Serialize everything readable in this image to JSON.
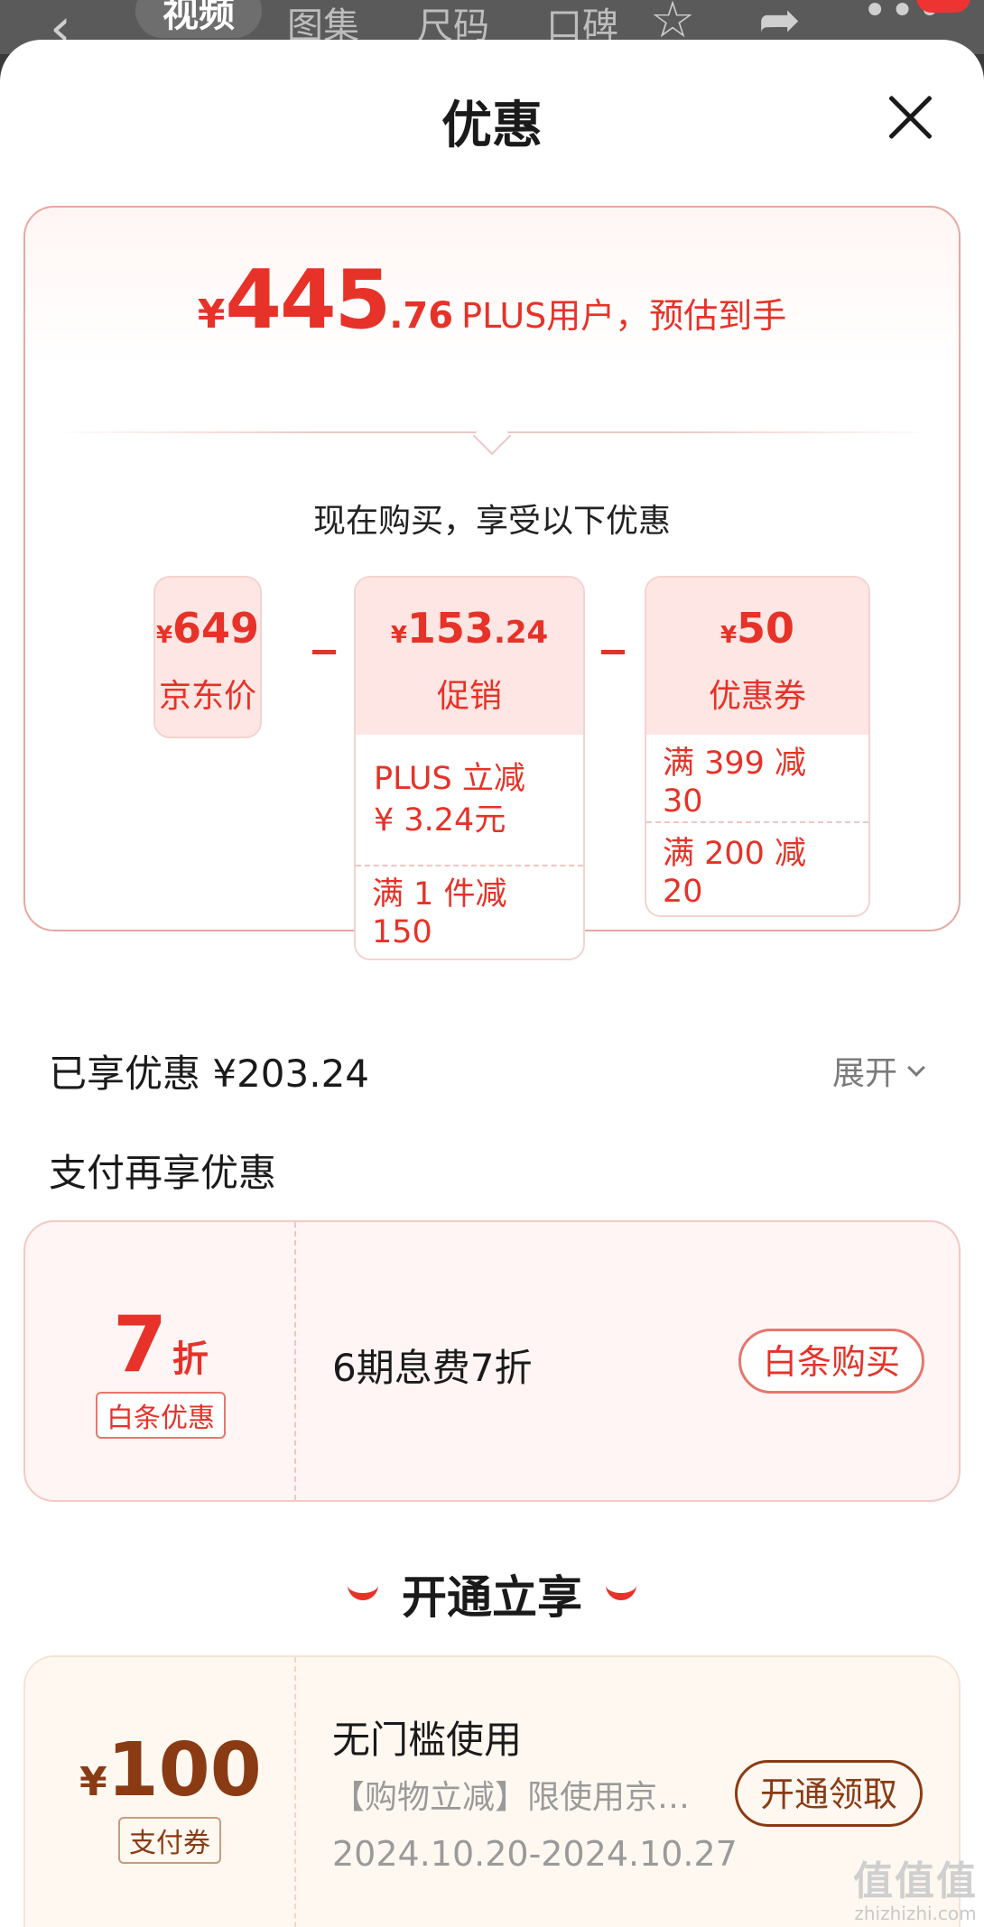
{
  "appbar": {
    "tabs": [
      "视频",
      "图集",
      "尺码",
      "口碑"
    ]
  },
  "sheet": {
    "title": "优惠"
  },
  "summary": {
    "currency": "¥",
    "price_int": "445",
    "price_dec": ".76",
    "price_label": "PLUS用户，预估到手",
    "buy_now": "现在购买，享受以下优惠",
    "jd_price": {
      "amount": "649",
      "label": "京东价"
    },
    "promo": {
      "amount_int": "153",
      "amount_dec": ".24",
      "label": "促销",
      "details": [
        "PLUS 立减\n¥ 3.24元",
        "满 1 件减 150"
      ],
      "detail_line1": "PLUS 立减",
      "detail_line2": "¥ 3.24元",
      "detail_2": "满 1 件减 150"
    },
    "coupon": {
      "amount": "50",
      "label": "优惠券",
      "detail_1": "满 399 减 30",
      "detail_2": "满 200 减 20"
    }
  },
  "enjoyed": {
    "text": "已享优惠 ¥203.24",
    "expand_label": "展开"
  },
  "pay_section": {
    "title": "支付再享优惠",
    "discount_num": "7",
    "discount_unit": "折",
    "tag": "白条优惠",
    "desc": "6期息费7折",
    "button": "白条购买"
  },
  "open_section": {
    "title": "开通立享",
    "currency": "¥",
    "amount": "100",
    "tag": "支付券",
    "line1": "无门槛使用",
    "line2": "【购物立减】限使用京…",
    "line3": "2024.10.20-2024.10.27",
    "button": "开通领取"
  },
  "watermark": {
    "logo": "值值值",
    "url": "zhizhizhi.com"
  },
  "colors": {
    "accent_red": "#e63228",
    "brown": "#8a3b14"
  }
}
